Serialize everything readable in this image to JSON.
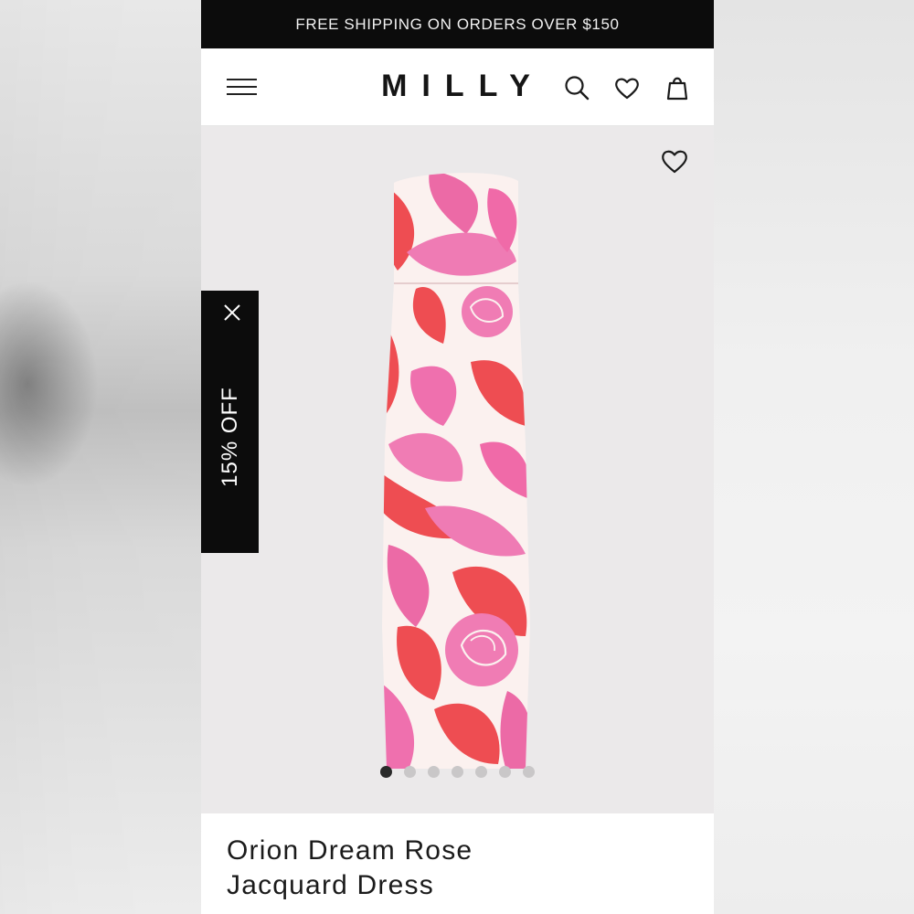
{
  "promo": {
    "text": "FREE SHIPPING ON ORDERS OVER $150"
  },
  "header": {
    "logo": "MILLY",
    "icons": [
      "menu-icon",
      "search-icon",
      "heart-icon",
      "bag-icon"
    ]
  },
  "discount_tab": {
    "label": "15% OFF",
    "close_icon": "close-icon"
  },
  "product": {
    "title_line1": "Orion Dream Rose",
    "title_line2": "Jacquard Dress",
    "image_count": 7,
    "active_image": 1,
    "colors": {
      "pink": "#ec6aa6",
      "coral": "#ee4d52",
      "cream": "#fbf1ef"
    }
  }
}
